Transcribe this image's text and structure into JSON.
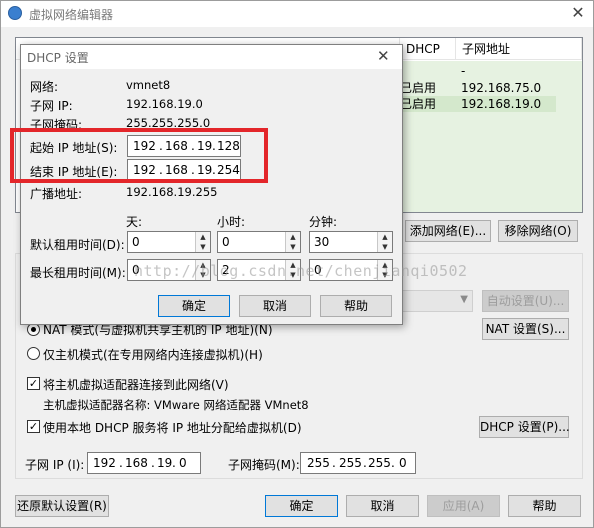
{
  "window": {
    "title": "虚拟网络编辑器",
    "close": "✕"
  },
  "table": {
    "headers": [
      "DHCP",
      "子网地址"
    ],
    "rows": [
      {
        "dhcp": "",
        "subnet": "-"
      },
      {
        "dhcp": "已启用",
        "subnet": "192.168.75.0"
      },
      {
        "dhcp": "已启用",
        "subnet": "192.168.19.0"
      }
    ]
  },
  "main": {
    "add_network": "添加网络(E)...",
    "remove_network": "移除网络(O)",
    "auto_settings": "自动设置(U)...",
    "nat_mode": "NAT 模式(与虚拟机共享主机的 IP 地址)(N)",
    "nat_settings": "NAT 设置(S)...",
    "host_only": "仅主机模式(在专用网络内连接虚拟机)(H)",
    "connect_adapter": "将主机虚拟适配器连接到此网络(V)",
    "adapter_name_label": "主机虚拟适配器名称: VMware 网络适配器 VMnet8",
    "use_dhcp": "使用本地 DHCP 服务将 IP 地址分配给虚拟机(D)",
    "dhcp_settings": "DHCP 设置(P)...",
    "subnet_ip_label": "子网 IP (I):",
    "subnet_ip": [
      "192",
      "168",
      "19",
      "0"
    ],
    "subnet_mask_label": "子网掩码(M):",
    "subnet_mask": [
      "255",
      "255",
      "255",
      "0"
    ],
    "restore_defaults": "还原默认设置(R)",
    "ok": "确定",
    "cancel": "取消",
    "apply": "应用(A)",
    "help": "帮助"
  },
  "dhcp_dialog": {
    "title": "DHCP 设置",
    "close": "✕",
    "network_label": "网络:",
    "network_value": "vmnet8",
    "subnet_ip_label": "子网 IP:",
    "subnet_ip_value": "192.168.19.0",
    "subnet_mask_label": "子网掩码:",
    "subnet_mask_value": "255.255.255.0",
    "start_ip_label": "起始 IP 地址(S):",
    "start_ip": [
      "192",
      "168",
      "19",
      "128"
    ],
    "end_ip_label": "结束 IP 地址(E):",
    "end_ip": [
      "192",
      "168",
      "19",
      "254"
    ],
    "broadcast_label": "广播地址:",
    "broadcast_value": "192.168.19.255",
    "col_days": "天:",
    "col_hours": "小时:",
    "col_minutes": "分钟:",
    "default_lease_label": "默认租用时间(D):",
    "default_lease": [
      "0",
      "0",
      "30"
    ],
    "max_lease_label": "最长租用时间(M):",
    "max_lease": [
      "0",
      "2",
      "0"
    ],
    "ok": "确定",
    "cancel": "取消",
    "help": "帮助"
  },
  "watermark": "http://blog.csdn.net/chenjianqi0502",
  "colors": {
    "highlight_red": "#e3262a",
    "row_green": "#e6f2e1",
    "row_selected": "#d9ecd3"
  }
}
